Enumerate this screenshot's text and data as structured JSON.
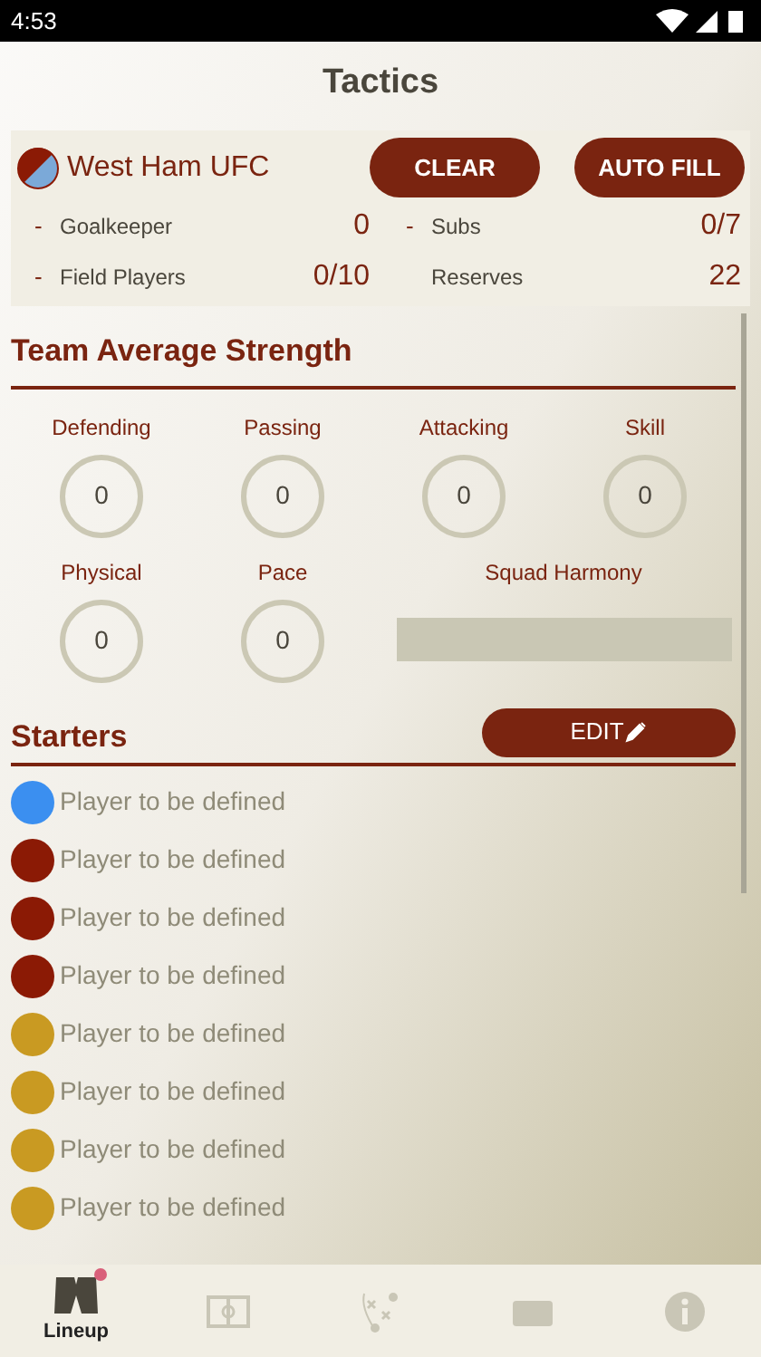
{
  "status_bar": {
    "time": "4:53"
  },
  "title": "Tactics",
  "team": {
    "name": "West Ham UFC"
  },
  "actions": [
    "CLEAR",
    "AUTO FILL"
  ],
  "counts": [
    {
      "marker": "-",
      "label": "Goalkeeper",
      "value": "0"
    },
    {
      "marker": "-",
      "label": "Subs",
      "value": "0/7"
    },
    {
      "marker": "-",
      "label": "Field Players",
      "value": "0/10"
    },
    {
      "label": "Reserves",
      "value": "22"
    }
  ],
  "strength": {
    "heading": "Team Average Strength",
    "stats": [
      {
        "label": "Defending",
        "value": "0"
      },
      {
        "label": "Passing",
        "value": "0"
      },
      {
        "label": "Attacking",
        "value": "0"
      },
      {
        "label": "Skill",
        "value": "0"
      },
      {
        "label": "Physical",
        "value": "0"
      },
      {
        "label": "Pace",
        "value": "0"
      }
    ],
    "harmony": {
      "label": "Squad Harmony",
      "level": 0
    }
  },
  "starters": {
    "heading": "Starters",
    "edit": "EDIT",
    "players": [
      {
        "name": "Player to be defined",
        "color": "#3b8ff0"
      },
      {
        "name": "Player to be defined",
        "color": "#8b1a05"
      },
      {
        "name": "Player to be defined",
        "color": "#8b1a05"
      },
      {
        "name": "Player to be defined",
        "color": "#8b1a05"
      },
      {
        "name": "Player to be defined",
        "color": "#c99a22"
      },
      {
        "name": "Player to be defined",
        "color": "#c99a22"
      },
      {
        "name": "Player to be defined",
        "color": "#c99a22"
      },
      {
        "name": "Player to be defined",
        "color": "#c99a22"
      }
    ]
  },
  "nav": [
    {
      "kind": "shirts",
      "label": "Lineup",
      "selected": true,
      "badge": true
    },
    {
      "kind": "pitch",
      "selected": false
    },
    {
      "kind": "tactics",
      "selected": false
    },
    {
      "kind": "money",
      "selected": false
    },
    {
      "kind": "info",
      "selected": false
    }
  ]
}
